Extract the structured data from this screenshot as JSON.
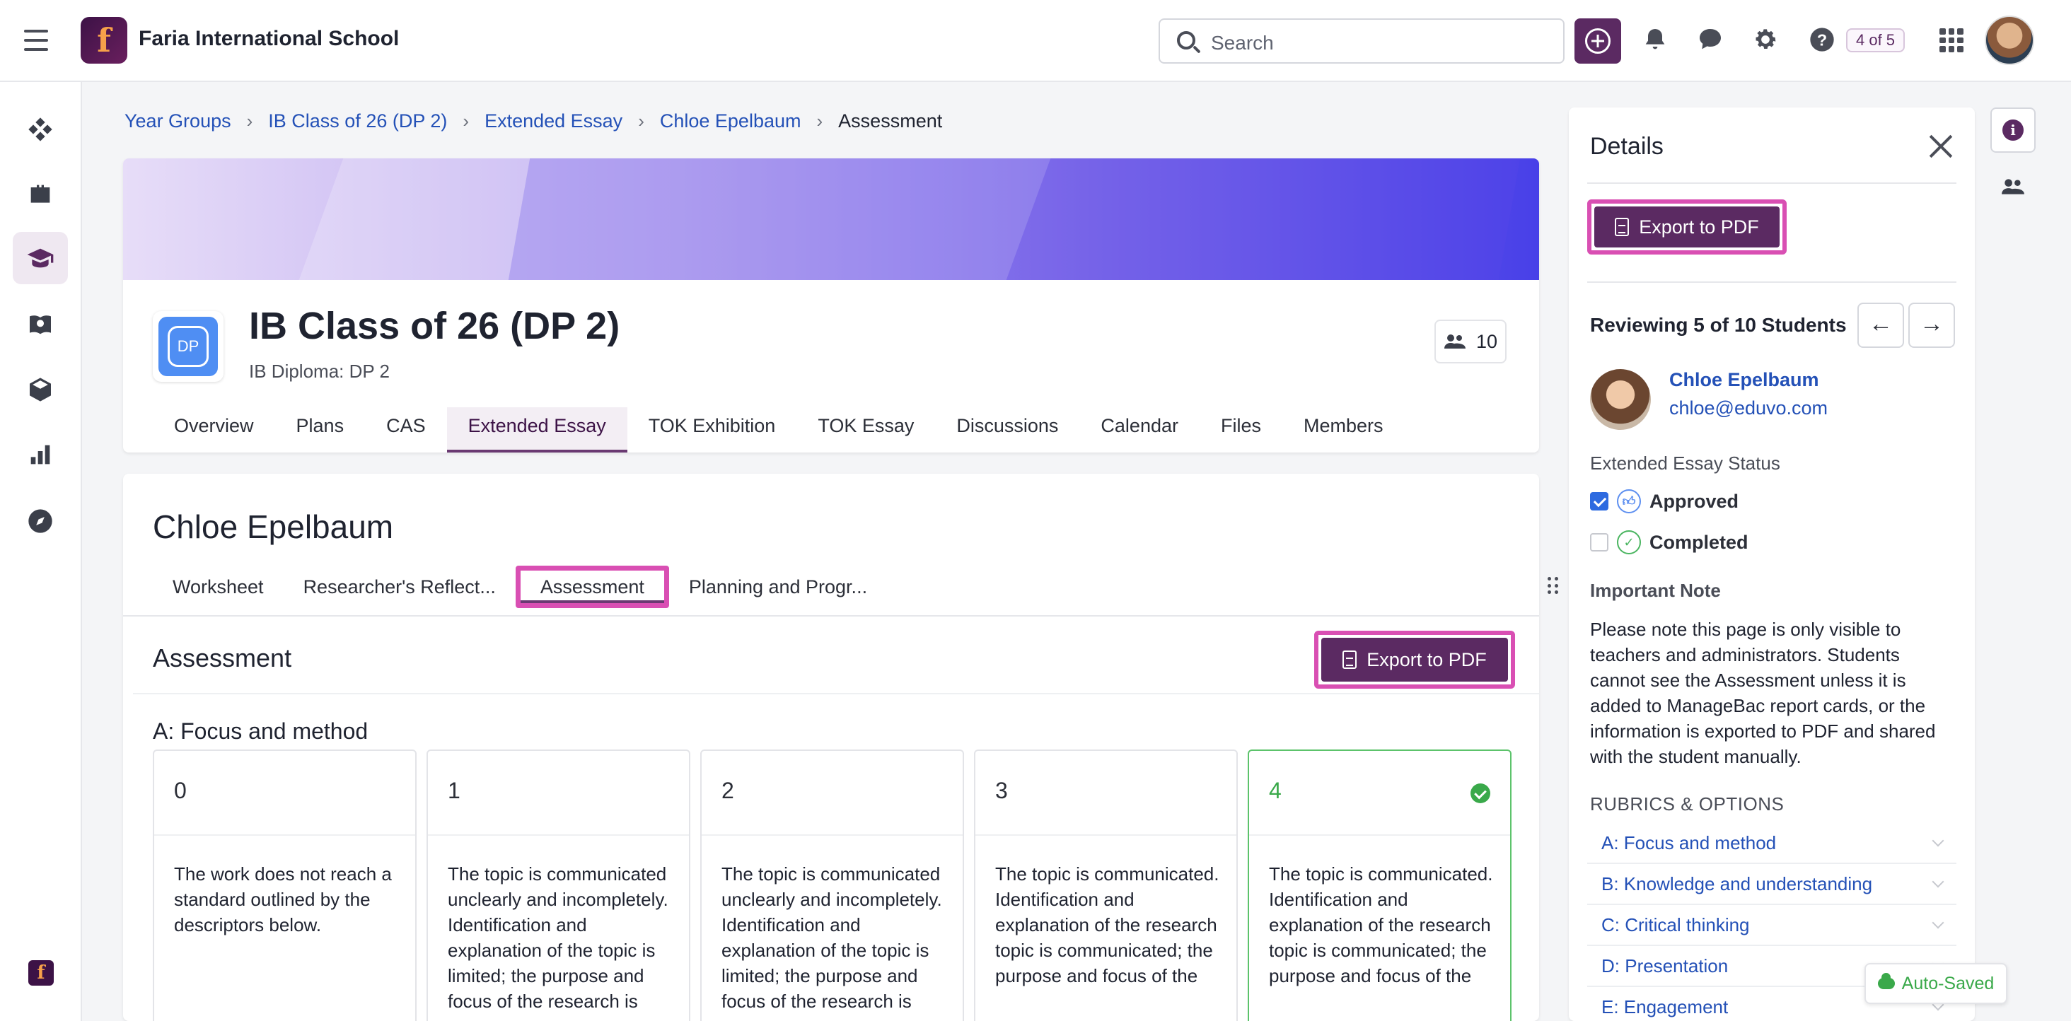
{
  "topbar": {
    "school_name": "Faria International School",
    "logo_letter": "f",
    "search_placeholder": "Search",
    "counter": "4 of 5"
  },
  "breadcrumb": [
    "Year Groups",
    "IB Class of 26 (DP 2)",
    "Extended Essay",
    "Chloe Epelbaum",
    "Assessment"
  ],
  "class": {
    "badge": "DP",
    "title": "IB Class of 26 (DP 2)",
    "subtitle": "IB Diploma: DP 2",
    "member_count": "10",
    "tabs": [
      "Overview",
      "Plans",
      "CAS",
      "Extended Essay",
      "TOK Exhibition",
      "TOK Essay",
      "Discussions",
      "Calendar",
      "Files",
      "Members"
    ],
    "active_tab": "Extended Essay"
  },
  "student": {
    "name": "Chloe Epelbaum",
    "subtabs": [
      "Worksheet",
      "Researcher's Reflect...",
      "Assessment",
      "Planning and Progr..."
    ],
    "active_subtab": "Assessment",
    "section_title": "Assessment",
    "export_label": "Export to PDF",
    "criterion_title": "A: Focus and method",
    "rubric": [
      {
        "score": "0",
        "desc": "The work does not reach a standard outlined by the descriptors below.",
        "selected": false
      },
      {
        "score": "1",
        "desc": "The topic is communicated unclearly and incompletely. Identification and explanation of the topic is limited; the purpose and focus of the research is",
        "selected": false
      },
      {
        "score": "2",
        "desc": "The topic is communicated unclearly and incompletely. Identification and explanation of the topic is limited; the purpose and focus of the research is",
        "selected": false
      },
      {
        "score": "3",
        "desc": "The topic is communicated. Identification and explanation of the research topic is communicated; the purpose and focus of the",
        "selected": false
      },
      {
        "score": "4",
        "desc": "The topic is communicated. Identification and explanation of the research topic is communicated; the purpose and focus of the",
        "selected": true
      }
    ]
  },
  "details": {
    "title": "Details",
    "export_label": "Export to PDF",
    "reviewing": "Reviewing 5 of 10 Students",
    "student_name": "Chloe Epelbaum",
    "student_email": "chloe@eduvo.com",
    "status_label": "Extended Essay Status",
    "statuses": [
      {
        "label": "Approved",
        "checked": true
      },
      {
        "label": "Completed",
        "checked": false
      }
    ],
    "note_title": "Important Note",
    "note_text": "Please note this page is only visible to teachers and administrators. Students cannot see the Assessment unless it is added to ManageBac report cards, or the information is exported to PDF and shared with the student manually.",
    "rubrics_label": "RUBRICS & OPTIONS",
    "rubrics": [
      "A: Focus and method",
      "B: Knowledge and understanding",
      "C: Critical thinking",
      "D: Presentation",
      "E: Engagement"
    ]
  },
  "autosaved": "Auto-Saved",
  "colors": {
    "brand": "#5b2a62",
    "highlight": "#d94fb3",
    "link": "#2451b7",
    "success": "#3aa94a"
  }
}
